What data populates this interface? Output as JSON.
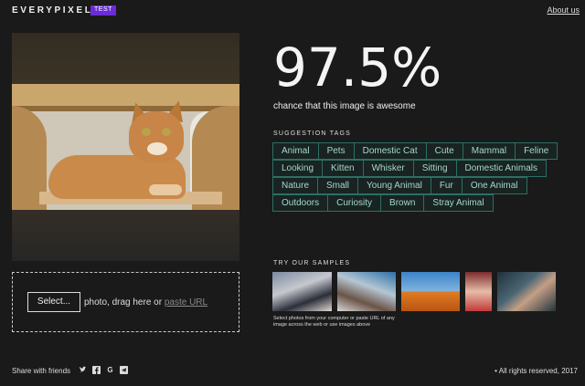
{
  "header": {
    "logo": "EVERYPIXEL",
    "badge": "TEST",
    "about_link": "About us"
  },
  "photo": {
    "subject": "cat"
  },
  "upload": {
    "select_button": "Select...",
    "text": "photo, drag here or",
    "paste_link": "paste URL"
  },
  "result": {
    "percentage": "97.5%",
    "caption": "chance that this image is awesome"
  },
  "tags": {
    "title": "SUGGESTION TAGS",
    "rows": [
      [
        "Animal",
        "Pets",
        "Domestic Cat",
        "Cute",
        "Mammal",
        "Feline"
      ],
      [
        "Looking",
        "Kitten",
        "Whisker",
        "Sitting",
        "Domestic Animals"
      ],
      [
        "Nature",
        "Small",
        "Young Animal",
        "Fur",
        "One Animal"
      ],
      [
        "Outdoors",
        "Curiosity",
        "Brown",
        "Stray Animal"
      ]
    ]
  },
  "samples": {
    "title": "TRY OUR SAMPLES",
    "hint": "Select photos from your computer or paste URL of any image across the web or use images above"
  },
  "footer": {
    "share": "Share with friends",
    "social": [
      "twitter-icon",
      "facebook-icon",
      "google-icon",
      "telegram-icon"
    ],
    "copyright": "All rights reserved, 2017"
  },
  "colors": {
    "background": "#1a1a1a",
    "badge": "#6b2bd6",
    "tag_border": "#2d6f63",
    "tag_text": "#a6d8c8"
  }
}
